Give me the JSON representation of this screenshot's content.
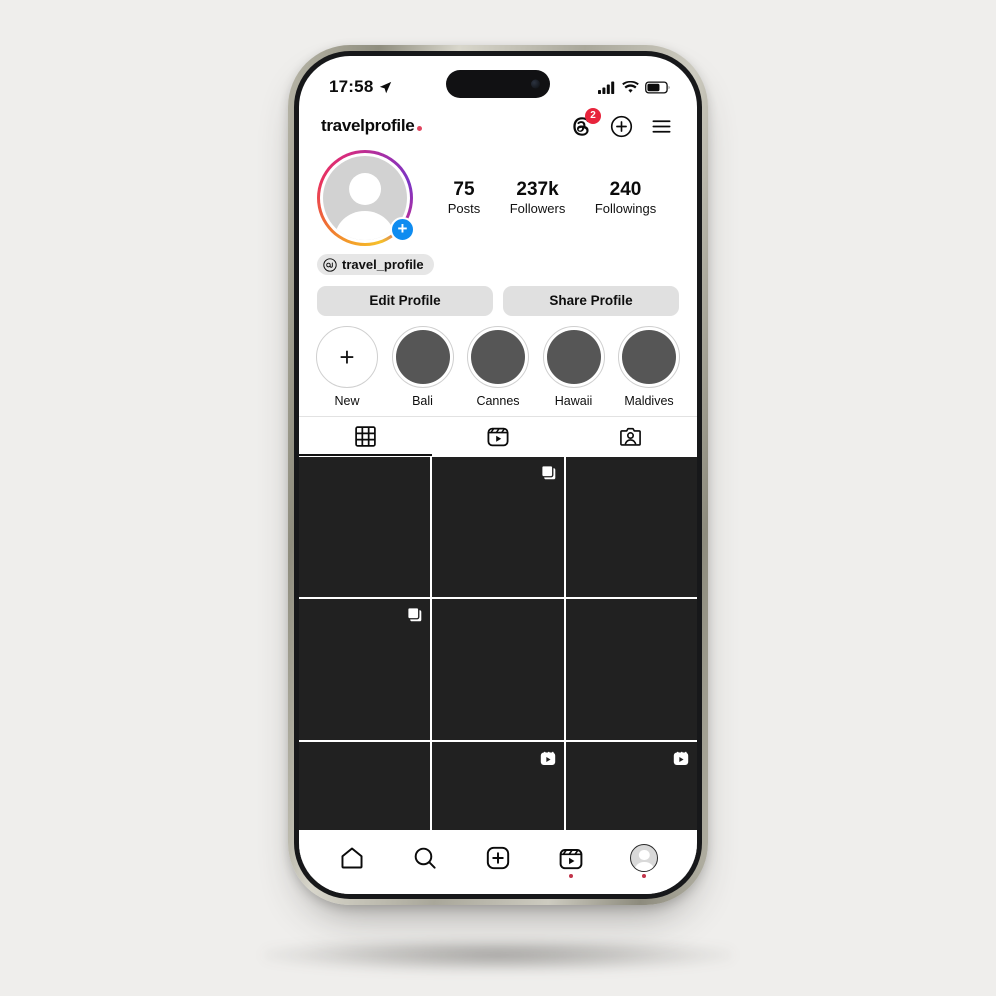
{
  "status_bar": {
    "time": "17:58",
    "location_icon": "location-arrow-icon",
    "signal_icon": "cellular-signal-icon",
    "wifi_icon": "wifi-icon",
    "battery_icon": "battery-icon",
    "battery_level_pct": 62
  },
  "header": {
    "brand": "travelprofile",
    "brand_dot_color": "#e0455f",
    "threads_icon": "threads-icon",
    "threads_badge": "2",
    "badge_color": "#e8243c",
    "add_icon": "plus-circle-icon",
    "menu_icon": "hamburger-menu-icon"
  },
  "profile": {
    "avatar_icon": "default-avatar-icon",
    "avatar_add_badge": "+",
    "handle": "travel_profile",
    "handle_icon": "threads-at-icon",
    "stats": [
      {
        "value": "75",
        "label": "Posts"
      },
      {
        "value": "237k",
        "label": "Followers"
      },
      {
        "value": "240",
        "label": "Followings"
      }
    ]
  },
  "actions": {
    "edit_profile": "Edit Profile",
    "share_profile": "Share Profile"
  },
  "highlights": [
    {
      "label": "New",
      "type": "new",
      "icon": "plus-icon"
    },
    {
      "label": "Bali",
      "type": "cover"
    },
    {
      "label": "Cannes",
      "type": "cover"
    },
    {
      "label": "Hawaii",
      "type": "cover"
    },
    {
      "label": "Maldives",
      "type": "cover"
    }
  ],
  "tabs": [
    {
      "name": "grid",
      "icon": "grid-icon",
      "active": true
    },
    {
      "name": "reels",
      "icon": "reels-icon",
      "active": false
    },
    {
      "name": "tagged",
      "icon": "tagged-person-icon",
      "active": false
    }
  ],
  "grid_posts": [
    {
      "overlay": null
    },
    {
      "overlay": "carousel-icon"
    },
    {
      "overlay": null
    },
    {
      "overlay": "carousel-icon"
    },
    {
      "overlay": null
    },
    {
      "overlay": null
    },
    {
      "overlay": null
    },
    {
      "overlay": "reels-icon"
    },
    {
      "overlay": "reels-icon"
    }
  ],
  "bottom_nav": [
    {
      "name": "home",
      "icon": "home-icon",
      "dot": false
    },
    {
      "name": "search",
      "icon": "search-icon",
      "dot": false
    },
    {
      "name": "create",
      "icon": "plus-square-icon",
      "dot": false
    },
    {
      "name": "reels",
      "icon": "reels-icon",
      "dot": true
    },
    {
      "name": "profile",
      "icon": "avatar-icon",
      "dot": true
    }
  ],
  "theme": {
    "background": "#efeeec",
    "screen_background": "#ffffff",
    "post_tile": "#212121",
    "accent_blue": "#0f8cf0",
    "button_grey": "#e0e0e0"
  }
}
